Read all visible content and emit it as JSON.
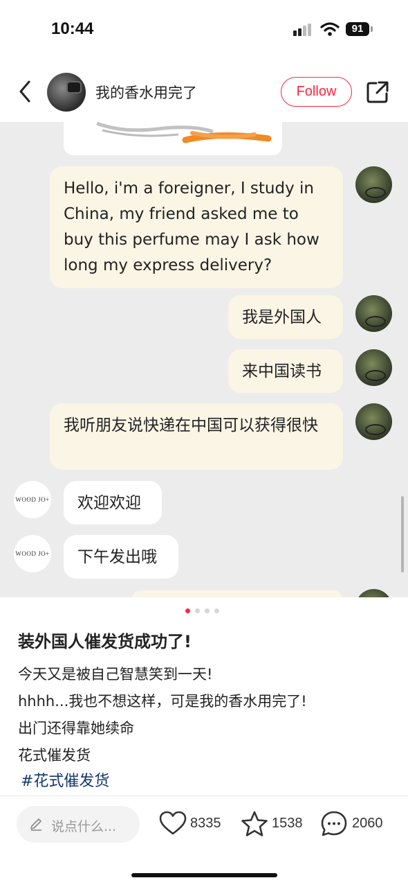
{
  "status_bar": {
    "time": "10:44",
    "battery": "91"
  },
  "header": {
    "title": "我的香水用完了",
    "follow_label": "Follow"
  },
  "chat": {
    "messages": [
      {
        "side": "mine",
        "text": "Hello, i'm a foreigner, I study in China, my friend asked me to buy this perfume may I ask how long my express delivery?"
      },
      {
        "side": "mine",
        "text": "我是外国人"
      },
      {
        "side": "mine",
        "text": "来中国读书"
      },
      {
        "side": "mine",
        "text": "我听朋友说快递在中国可以获得很快"
      },
      {
        "side": "theirs",
        "text": "欢迎欢迎"
      },
      {
        "side": "theirs",
        "text": "下午发出哦"
      }
    ],
    "shop_avatar_text": "WOOD JO+"
  },
  "post": {
    "title": "装外国人催发货成功了!",
    "lines": [
      "今天又是被自己智慧笑到一天!",
      "hhhh...我也不想这样，可是我的香水用完了!",
      "出门还得靠她续命",
      "花式催发货"
    ],
    "hashtag": "#花式催发货"
  },
  "actions": {
    "comment_placeholder": "说点什么...",
    "likes": "8335",
    "favorites": "1538",
    "comments": "2060"
  },
  "carousel": {
    "total": 4,
    "current": 1
  },
  "colors": {
    "accent": "#ff2442",
    "my_bubble": "#fbf5e6",
    "hashtag": "#13386c"
  }
}
